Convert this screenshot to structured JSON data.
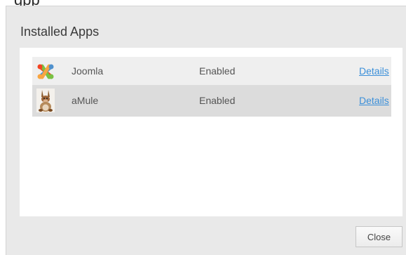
{
  "dialog": {
    "title": "Installed Apps",
    "close_label": "Close"
  },
  "apps": [
    {
      "name": "Joomla",
      "status": "Enabled",
      "details_label": "Details",
      "icon": "joomla-logo-icon"
    },
    {
      "name": "aMule",
      "status": "Enabled",
      "details_label": "Details",
      "icon": "amule-mule-icon"
    }
  ],
  "colors": {
    "dialog_background": "#e9e9e9",
    "panel_background": "#ffffff",
    "row_odd": "#efefef",
    "row_even": "#dcdcdc",
    "link": "#3b8fd9"
  }
}
